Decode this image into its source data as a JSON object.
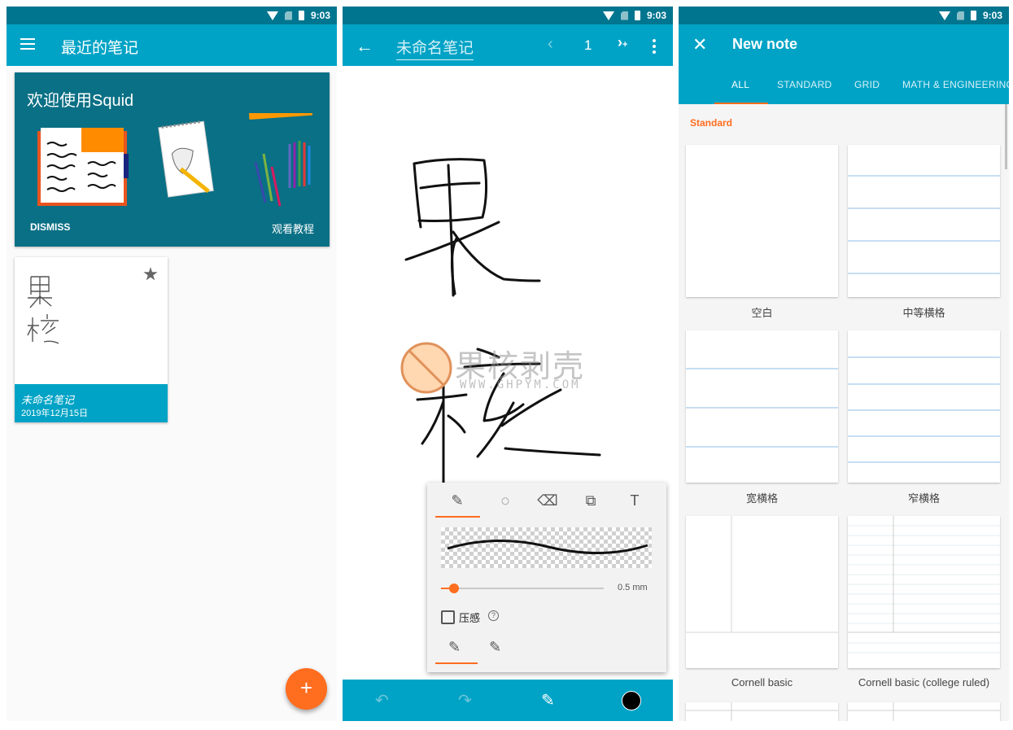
{
  "status": {
    "time": "9:03"
  },
  "screen1": {
    "title": "最近的笔记",
    "welcome": {
      "title": "欢迎使用Squid",
      "dismiss": "DISMISS",
      "tutorial": "观看教程"
    },
    "note": {
      "title": "未命名笔记",
      "date": "2019年12月15日"
    },
    "fab_label": "+"
  },
  "screen2": {
    "note_name": "未命名笔记",
    "page_number": "1",
    "stroke_size": "0.5 mm",
    "stroke_size_fraction": 0.08,
    "pressure_label": "压感",
    "help_glyph": "?",
    "watermark": {
      "text": "果核剥壳",
      "url": "WWW.GHPYM.COM"
    }
  },
  "screen3": {
    "title": "New note",
    "tabs": [
      "ALL",
      "STANDARD",
      "GRID",
      "MATH & ENGINEERING"
    ],
    "section": "Standard",
    "templates": [
      "空白",
      "中等横格",
      "宽横格",
      "窄横格",
      "Cornell basic",
      "Cornell basic (college ruled)"
    ]
  },
  "colors": {
    "accent": "#ff6d1f",
    "primary": "#00a3c6",
    "dark_primary": "#00758f"
  }
}
